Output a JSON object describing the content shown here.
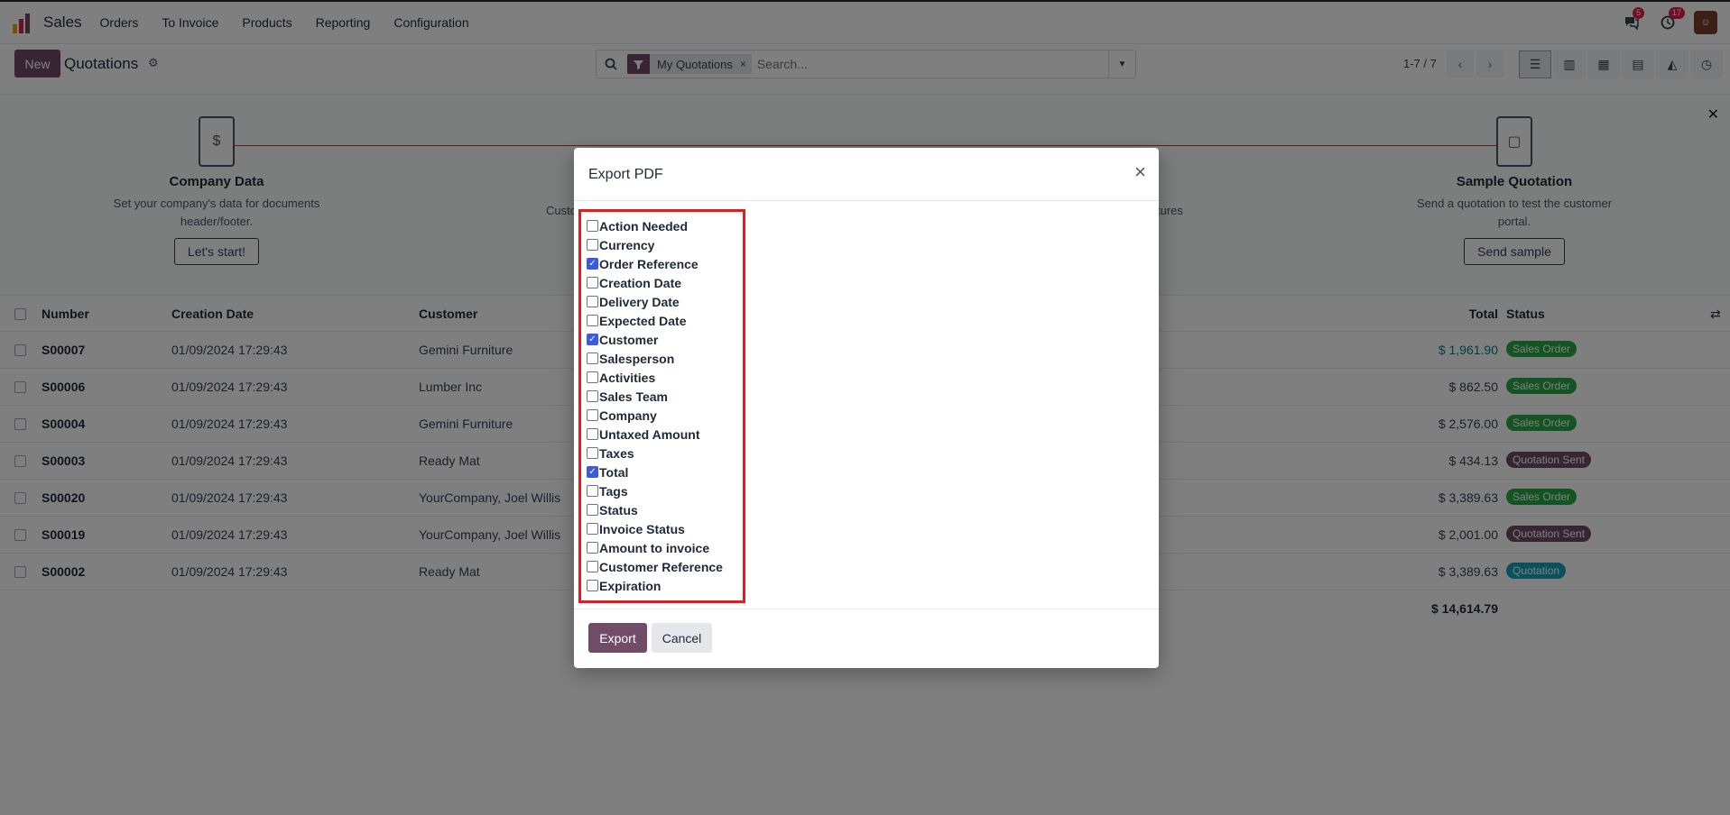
{
  "app": {
    "name": "Sales",
    "menu": [
      "Orders",
      "To Invoice",
      "Products",
      "Reporting",
      "Configuration"
    ],
    "chat_badge": "5",
    "activity_badge": "17"
  },
  "control": {
    "new_label": "New",
    "title": "Quotations",
    "facet_label": "My Quotations",
    "search_placeholder": "Search...",
    "pager": "1-7 / 7"
  },
  "banner": {
    "steps": [
      {
        "title": "Company Data",
        "desc1": "Set your company's data for documents",
        "desc2": "header/footer.",
        "button": "Let's start!"
      },
      {
        "title": "Sample Quotation",
        "desc1": "Send a quotation to test the customer",
        "desc2": "portal.",
        "button": "Send sample"
      }
    ],
    "partial_left": "Custo",
    "partial_right": "tures"
  },
  "list": {
    "headers": {
      "number": "Number",
      "date": "Creation Date",
      "customer": "Customer",
      "total": "Total",
      "status": "Status"
    },
    "rows": [
      {
        "number": "S00007",
        "date": "01/09/2024 17:29:43",
        "customer": "Gemini Furniture",
        "total": "$ 1,961.90",
        "status": "Sales Order"
      },
      {
        "number": "S00006",
        "date": "01/09/2024 17:29:43",
        "customer": "Lumber Inc",
        "total": "$ 862.50",
        "status": "Sales Order"
      },
      {
        "number": "S00004",
        "date": "01/09/2024 17:29:43",
        "customer": "Gemini Furniture",
        "total": "$ 2,576.00",
        "status": "Sales Order"
      },
      {
        "number": "S00003",
        "date": "01/09/2024 17:29:43",
        "customer": "Ready Mat",
        "total": "$ 434.13",
        "status": "Quotation Sent"
      },
      {
        "number": "S00020",
        "date": "01/09/2024 17:29:43",
        "customer": "YourCompany, Joel Willis",
        "total": "$ 3,389.63",
        "status": "Sales Order"
      },
      {
        "number": "S00019",
        "date": "01/09/2024 17:29:43",
        "customer": "YourCompany, Joel Willis",
        "total": "$ 2,001.00",
        "status": "Quotation Sent"
      },
      {
        "number": "S00002",
        "date": "01/09/2024 17:29:43",
        "customer": "Ready Mat",
        "total": "$ 3,389.63",
        "status": "Quotation"
      }
    ],
    "sum_total": "$ 14,614.79",
    "status_colors": {
      "Sales Order": "#28a745",
      "Quotation Sent": "#714b67",
      "Quotation": "#17a2b8"
    }
  },
  "modal": {
    "title": "Export PDF",
    "fields": [
      {
        "label": "Action Needed",
        "checked": false
      },
      {
        "label": "Currency",
        "checked": false
      },
      {
        "label": "Order Reference",
        "checked": true
      },
      {
        "label": "Creation Date",
        "checked": false
      },
      {
        "label": "Delivery Date",
        "checked": false
      },
      {
        "label": "Expected Date",
        "checked": false
      },
      {
        "label": "Customer",
        "checked": true
      },
      {
        "label": "Salesperson",
        "checked": false
      },
      {
        "label": "Activities",
        "checked": false
      },
      {
        "label": "Sales Team",
        "checked": false
      },
      {
        "label": "Company",
        "checked": false
      },
      {
        "label": "Untaxed Amount",
        "checked": false
      },
      {
        "label": "Taxes",
        "checked": false
      },
      {
        "label": "Total",
        "checked": true
      },
      {
        "label": "Tags",
        "checked": false
      },
      {
        "label": "Status",
        "checked": false
      },
      {
        "label": "Invoice Status",
        "checked": false
      },
      {
        "label": "Amount to invoice",
        "checked": false
      },
      {
        "label": "Customer Reference",
        "checked": false
      },
      {
        "label": "Expiration",
        "checked": false
      }
    ],
    "export_label": "Export",
    "cancel_label": "Cancel"
  },
  "colors": {
    "brand": "#714b67",
    "highlight_box": "#e11d1d",
    "checkbox_on": "#3b5bdb"
  }
}
